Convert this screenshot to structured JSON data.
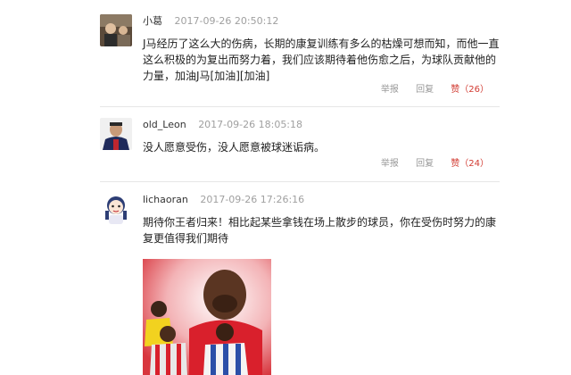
{
  "comments": [
    {
      "user": "小葛",
      "time": "2017-09-26 20:50:12",
      "text": "J马经历了这么大的伤病，长期的康复训练有多么的枯燥可想而知，而他一直这么积极的为复出而努力着，我们应该期待着他伤愈之后，为球队贡献他的力量，加油J马[加油][加油]",
      "report_label": "举报",
      "reply_label": "回复",
      "like_label": "赞（26）"
    },
    {
      "user": "old_Leon",
      "time": "2017-09-26 18:05:18",
      "text": "没人愿意受伤，没人愿意被球迷诟病。",
      "report_label": "举报",
      "reply_label": "回复",
      "like_label": "赞（24）"
    },
    {
      "user": "lichaoran",
      "time": "2017-09-26 17:26:16",
      "text": "期待你王者归来！相比起某些拿钱在场上散步的球员，你在受伤时努力的康复更值得我们期待"
    }
  ],
  "colors": {
    "like": "#d23b32",
    "meta": "#a0a0a0",
    "divider": "#e6e6e6"
  }
}
